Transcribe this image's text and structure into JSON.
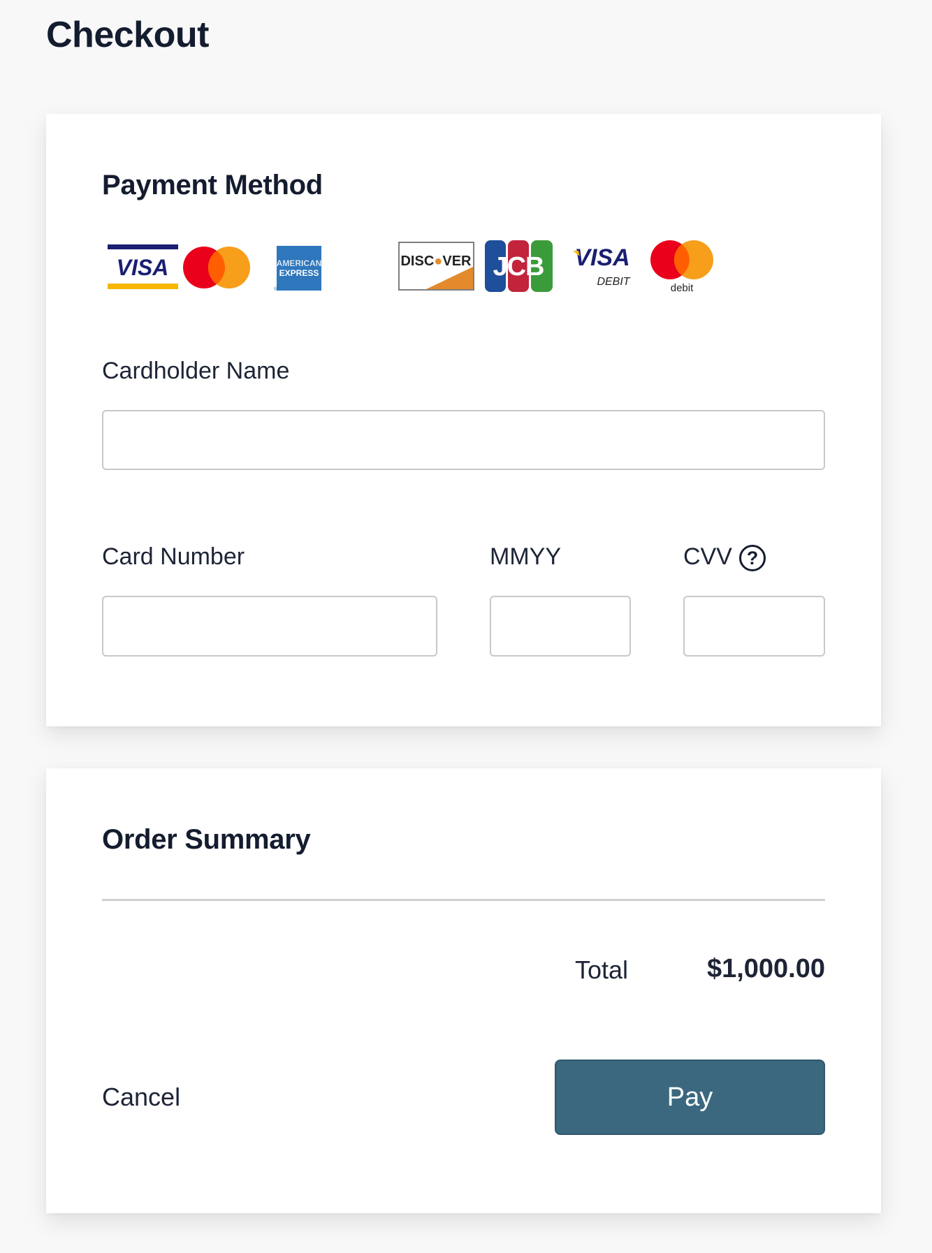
{
  "page": {
    "title": "Checkout"
  },
  "payment_method": {
    "title": "Payment Method",
    "brands": [
      {
        "name": "visa-logo",
        "text": "VISA"
      },
      {
        "name": "mastercard-logo",
        "text": ""
      },
      {
        "name": "american-express-logo",
        "text": "AMERICAN EXPRESS"
      },
      {
        "name": "discover-logo",
        "text": "DISCOVER"
      },
      {
        "name": "jcb-logo",
        "text": "JCB"
      },
      {
        "name": "visa-debit-logo",
        "text": "VISA DEBIT"
      },
      {
        "name": "mastercard-debit-logo",
        "text": "debit"
      }
    ],
    "cardholder_name": {
      "label": "Cardholder Name",
      "value": "",
      "placeholder": ""
    },
    "card_number": {
      "label": "Card Number",
      "value": "",
      "placeholder": ""
    },
    "expiry": {
      "label": "MMYY",
      "value": "",
      "placeholder": ""
    },
    "cvv": {
      "label": "CVV",
      "value": "",
      "placeholder": "",
      "help_icon": "question-circle-icon"
    }
  },
  "order_summary": {
    "title": "Order Summary",
    "total_label": "Total",
    "total_value": "$1,000.00",
    "cancel_label": "Cancel",
    "pay_label": "Pay"
  },
  "colors": {
    "background": "#f8f8f9",
    "card": "#ffffff",
    "text": "#141c2f",
    "pay_button": "#3b687f",
    "input_border": "#c7c8cc"
  }
}
